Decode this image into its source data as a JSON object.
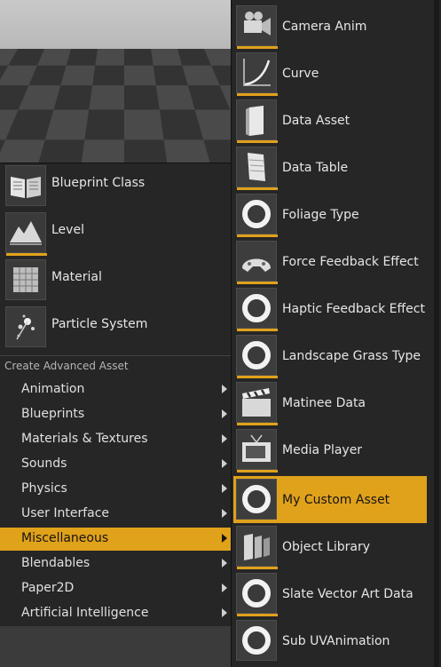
{
  "basic_assets": [
    {
      "label": "Blueprint Class",
      "icon": "blueprint-book-icon"
    },
    {
      "label": "Level",
      "icon": "level-terrain-icon"
    },
    {
      "label": "Material",
      "icon": "material-sphere-icon"
    },
    {
      "label": "Particle System",
      "icon": "particle-burst-icon"
    }
  ],
  "advanced": {
    "title": "Create Advanced Asset",
    "categories": [
      {
        "label": "Animation"
      },
      {
        "label": "Blueprints"
      },
      {
        "label": "Materials & Textures"
      },
      {
        "label": "Sounds"
      },
      {
        "label": "Physics"
      },
      {
        "label": "User Interface"
      },
      {
        "label": "Miscellaneous"
      },
      {
        "label": "Blendables"
      },
      {
        "label": "Paper2D"
      },
      {
        "label": "Artificial Intelligence"
      }
    ],
    "selected": "Miscellaneous"
  },
  "submenu": {
    "items": [
      {
        "label": "Camera Anim",
        "icon": "camera-icon"
      },
      {
        "label": "Curve",
        "icon": "curve-icon"
      },
      {
        "label": "Data Asset",
        "icon": "data-asset-icon"
      },
      {
        "label": "Data Table",
        "icon": "data-table-icon"
      },
      {
        "label": "Foliage Type",
        "icon": "ring-icon"
      },
      {
        "label": "Force Feedback Effect",
        "icon": "force-feedback-icon"
      },
      {
        "label": "Haptic Feedback Effect",
        "icon": "ring-icon"
      },
      {
        "label": "Landscape Grass Type",
        "icon": "ring-icon"
      },
      {
        "label": "Matinee Data",
        "icon": "clapperboard-icon"
      },
      {
        "label": "Media Player",
        "icon": "television-icon"
      },
      {
        "label": "My Custom Asset",
        "icon": "ring-icon"
      },
      {
        "label": "Object Library",
        "icon": "object-library-icon"
      },
      {
        "label": "Slate Vector Art Data",
        "icon": "ring-icon"
      },
      {
        "label": "Sub UVAnimation",
        "icon": "ring-icon"
      }
    ],
    "selected": "My Custom Asset"
  },
  "colors": {
    "accent": "#e0a11b",
    "panel": "#262626"
  }
}
